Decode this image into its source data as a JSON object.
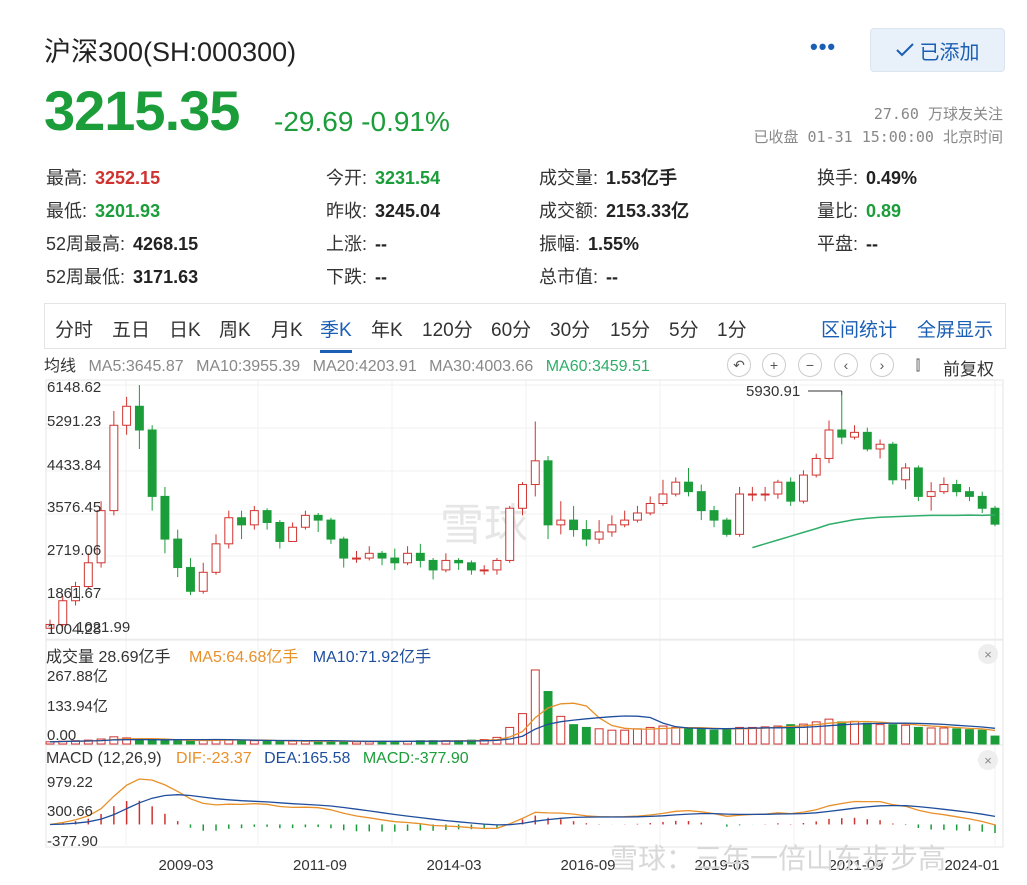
{
  "header": {
    "title": "沪深300(SH:000300)",
    "more_label": "•••",
    "added_label": "已添加",
    "price": "3215.35",
    "change": "-29.69 -0.91%",
    "followers": "27.60 万球友关注",
    "close_time": "已收盘 01-31 15:00:00 北京时间"
  },
  "stats": {
    "high": {
      "label": "最高:",
      "value": "3252.15"
    },
    "open": {
      "label": "今开:",
      "value": "3231.54"
    },
    "volume": {
      "label": "成交量:",
      "value": "1.53亿手"
    },
    "turnover": {
      "label": "换手:",
      "value": "0.49%"
    },
    "low": {
      "label": "最低:",
      "value": "3201.93"
    },
    "prev_close": {
      "label": "昨收:",
      "value": "3245.04"
    },
    "amount": {
      "label": "成交额:",
      "value": "2153.33亿"
    },
    "vol_ratio": {
      "label": "量比:",
      "value": "0.89"
    },
    "w52_high": {
      "label": "52周最高:",
      "value": "4268.15"
    },
    "up": {
      "label": "上涨:",
      "value": "--"
    },
    "amplitude": {
      "label": "振幅:",
      "value": "1.55%"
    },
    "flat": {
      "label": "平盘:",
      "value": "--"
    },
    "w52_low": {
      "label": "52周最低:",
      "value": "3171.63"
    },
    "down": {
      "label": "下跌:",
      "value": "--"
    },
    "mktcap": {
      "label": "总市值:",
      "value": "--"
    }
  },
  "tabs": [
    "分时",
    "五日",
    "日K",
    "周K",
    "月K",
    "季K",
    "年K",
    "120分",
    "60分",
    "30分",
    "15分",
    "5分",
    "1分"
  ],
  "active_tab": "季K",
  "links": {
    "range_stats": "区间统计",
    "fullscreen": "全屏显示"
  },
  "ma_legend": {
    "avg": "均线",
    "ma5": "MA5:3645.87",
    "ma10": "MA10:3955.39",
    "ma20": "MA20:4203.91",
    "ma30": "MA30:4003.66",
    "ma60": "MA60:3459.51"
  },
  "controls": {
    "undo": "↶",
    "zoom_in": "+",
    "zoom_out": "−",
    "prev": "‹",
    "next": "›",
    "candle": "⫿",
    "adjust": "前复权"
  },
  "volume_legend": {
    "total": "成交量 28.69亿手",
    "ma5": "MA5:64.68亿手",
    "ma10": "MA10:71.92亿手"
  },
  "macd_legend": {
    "title": "MACD (12,26,9)",
    "dif": "DIF:-23.37",
    "dea": "DEA:165.58",
    "macd": "MACD:-377.90"
  },
  "close_icon": "×",
  "watermark": "雪球",
  "footer_watermark": "雪球：三年一倍山东步步高",
  "colors": {
    "up": "#d0332f",
    "down": "#1b9d3a",
    "link": "#1a5fb4",
    "ma5": "#e8902a",
    "ma10": "#1f4e9c",
    "ma60": "#2fae6a"
  },
  "chart_data": {
    "type": "candlestick",
    "period": "quarterly",
    "y_ticks": [
      "6148.62",
      "5291.23",
      "4433.84",
      "3576.45",
      "2719.06",
      "1861.67",
      "1004.28"
    ],
    "low_annotation": "1021.99",
    "high_annotation": "5930.91",
    "x_ticks": [
      "2009-03",
      "2011-09",
      "2014-03",
      "2016-09",
      "2019-03",
      "2021-09",
      "2024-01"
    ],
    "candles": [
      [
        1020,
        1100,
        1200,
        1000
      ],
      [
        1100,
        1600,
        1700,
        1050
      ],
      [
        1600,
        1900,
        2000,
        1500
      ],
      [
        1900,
        2400,
        2600,
        1850
      ],
      [
        2400,
        3500,
        3700,
        2300
      ],
      [
        3500,
        5300,
        5600,
        3400
      ],
      [
        5300,
        5700,
        5900,
        5100
      ],
      [
        5700,
        5200,
        6148,
        4800
      ],
      [
        5200,
        3800,
        5300,
        3500
      ],
      [
        3800,
        2900,
        4000,
        2600
      ],
      [
        2900,
        2300,
        3100,
        2100
      ],
      [
        2300,
        1800,
        2500,
        1720
      ],
      [
        1800,
        2200,
        2400,
        1750
      ],
      [
        2200,
        2800,
        3000,
        2150
      ],
      [
        2800,
        3350,
        3500,
        2700
      ],
      [
        3350,
        3200,
        3500,
        2900
      ],
      [
        3200,
        3500,
        3600,
        3100
      ],
      [
        3500,
        3250,
        3550,
        3100
      ],
      [
        3250,
        2850,
        3300,
        2700
      ],
      [
        2850,
        3150,
        3250,
        2850
      ],
      [
        3150,
        3400,
        3500,
        3100
      ],
      [
        3400,
        3300,
        3450,
        3050
      ],
      [
        3300,
        2900,
        3350,
        2800
      ],
      [
        2900,
        2500,
        2950,
        2300
      ],
      [
        2500,
        2500,
        2650,
        2400
      ],
      [
        2500,
        2600,
        2750,
        2450
      ],
      [
        2600,
        2500,
        2650,
        2350
      ],
      [
        2500,
        2400,
        2700,
        2250
      ],
      [
        2400,
        2600,
        2750,
        2350
      ],
      [
        2600,
        2450,
        2800,
        2300
      ],
      [
        2450,
        2250,
        2500,
        2050
      ],
      [
        2250,
        2450,
        2600,
        2200
      ],
      [
        2450,
        2400,
        2500,
        2250
      ],
      [
        2400,
        2250,
        2450,
        2150
      ],
      [
        2250,
        2250,
        2350,
        2150
      ],
      [
        2250,
        2450,
        2500,
        2150
      ],
      [
        2450,
        3550,
        3600,
        2400
      ],
      [
        3550,
        4050,
        4100,
        3400
      ],
      [
        4050,
        4550,
        5380,
        3800
      ],
      [
        4550,
        3200,
        4650,
        2900
      ],
      [
        3200,
        3300,
        3700,
        3000
      ],
      [
        3300,
        3100,
        3600,
        2950
      ],
      [
        3100,
        2900,
        3300,
        2750
      ],
      [
        2900,
        3050,
        3300,
        2800
      ],
      [
        3050,
        3200,
        3400,
        2950
      ],
      [
        3200,
        3300,
        3500,
        3150
      ],
      [
        3300,
        3450,
        3600,
        3250
      ],
      [
        3450,
        3650,
        3800,
        3400
      ],
      [
        3650,
        3850,
        4150,
        3600
      ],
      [
        3850,
        4100,
        4200,
        3800
      ],
      [
        4100,
        3900,
        4400,
        3800
      ],
      [
        3900,
        3500,
        4050,
        3300
      ],
      [
        3500,
        3300,
        3600,
        3150
      ],
      [
        3300,
        3000,
        3350,
        2950
      ],
      [
        3000,
        3850,
        4000,
        2950
      ],
      [
        3850,
        3850,
        4000,
        3700
      ],
      [
        3850,
        3850,
        4000,
        3700
      ],
      [
        3850,
        4100,
        4150,
        3750
      ],
      [
        4100,
        3700,
        4200,
        3600
      ],
      [
        3700,
        4250,
        4350,
        3650
      ],
      [
        4250,
        4600,
        4700,
        4200
      ],
      [
        4600,
        5200,
        5400,
        4500
      ],
      [
        5200,
        5050,
        5930,
        4900
      ],
      [
        5050,
        5150,
        5300,
        5000
      ],
      [
        5150,
        4800,
        5250,
        4750
      ],
      [
        4800,
        4900,
        5000,
        4600
      ],
      [
        4900,
        4150,
        4950,
        4050
      ],
      [
        4150,
        4400,
        4500,
        3950
      ],
      [
        4400,
        3800,
        4450,
        3700
      ],
      [
        3800,
        3900,
        4100,
        3500
      ],
      [
        3900,
        4050,
        4200,
        3850
      ],
      [
        4050,
        3900,
        4150,
        3800
      ],
      [
        3900,
        3800,
        4000,
        3700
      ],
      [
        3800,
        3550,
        3900,
        3450
      ],
      [
        3550,
        3215,
        3600,
        3170
      ]
    ],
    "ma60_start_index": 55,
    "ma60_values": [
      2720,
      2800,
      2880,
      2960,
      3040,
      3120,
      3210,
      3260,
      3310,
      3340,
      3360,
      3370,
      3380,
      3390,
      3400,
      3400,
      3400,
      3405,
      3400,
      3410
    ],
    "volume": {
      "ylabels": [
        "267.88亿",
        "133.94亿",
        "0.00"
      ],
      "max": 267.88
    },
    "macd": {
      "ylabels": [
        "979.22",
        "300.66",
        "-377.90"
      ],
      "max": 979.22,
      "min": -377.9
    }
  }
}
